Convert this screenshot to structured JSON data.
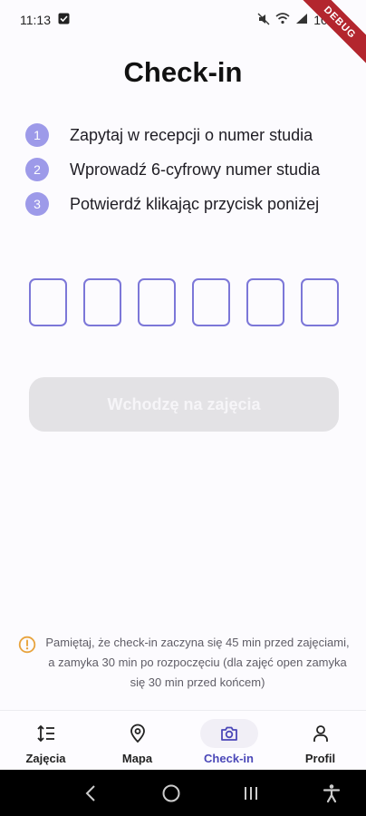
{
  "status_bar": {
    "time": "11:13",
    "battery": "100%"
  },
  "ribbon": {
    "label": "DEBUG"
  },
  "title": "Check-in",
  "steps": [
    {
      "num": "1",
      "text": "Zapytaj w recepcji o numer studia"
    },
    {
      "num": "2",
      "text": "Wprowadź 6-cyfrowy numer studia"
    },
    {
      "num": "3",
      "text": "Potwierdź klikając przycisk poniżej"
    }
  ],
  "code": {
    "length": 6,
    "values": [
      "",
      "",
      "",
      "",
      "",
      ""
    ]
  },
  "submit_button": {
    "label": "Wchodzę na zajęcia",
    "enabled": false
  },
  "note": "Pamiętaj, że check-in zaczyna się 45 min przed zajęciami, a zamyka 30 min po rozpoczęciu (dla zajęć open zamyka się 30 min przed końcem)",
  "nav": [
    {
      "label": "Zajęcia",
      "icon": "sort-list-icon",
      "active": false
    },
    {
      "label": "Mapa",
      "icon": "map-pin-icon",
      "active": false
    },
    {
      "label": "Check-in",
      "icon": "camera-icon",
      "active": true
    },
    {
      "label": "Profil",
      "icon": "person-icon",
      "active": false
    }
  ],
  "colors": {
    "accent": "#9d9ae9",
    "box_border": "#7c77d8",
    "active_nav": "#4b48b8",
    "warning": "#e8a33d",
    "button_disabled": "#e3e2e5"
  }
}
